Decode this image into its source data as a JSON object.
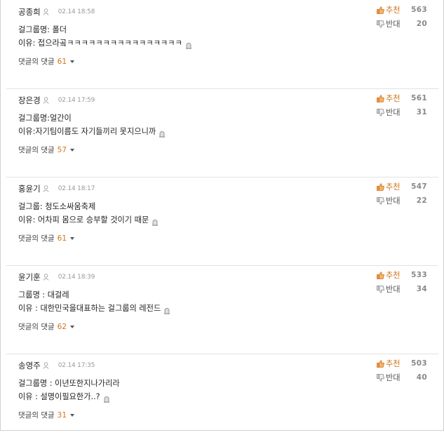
{
  "comments": [
    {
      "author": "공종희",
      "time": "02.14 18:58",
      "lines": [
        "걸그룹명: 폴더",
        "이유: 접으라곸ㅋㅋㅋㅋㅋㅋㅋㅋㅋㅋㅋㅋㅋㅋㅋㅋ"
      ],
      "replies_label": "댓글의 댓글",
      "replies_count": "61",
      "up_label": "추천",
      "up_count": "563",
      "down_label": "반대",
      "down_count": "20"
    },
    {
      "author": "장은경",
      "time": "02.14 17:59",
      "lines": [
        "걸그룹명:얼간이",
        "이유:자기팀이름도 자기들끼리 못지으니까"
      ],
      "replies_label": "댓글의 댓글",
      "replies_count": "57",
      "up_label": "추천",
      "up_count": "561",
      "down_label": "반대",
      "down_count": "31"
    },
    {
      "author": "홍윤기",
      "time": "02.14 18:17",
      "lines": [
        "걸그룹: 청도소싸움축제",
        "이유: 어차피 몸으로 승부할 것이기 때문"
      ],
      "replies_label": "댓글의 댓글",
      "replies_count": "61",
      "up_label": "추천",
      "up_count": "547",
      "down_label": "반대",
      "down_count": "22"
    },
    {
      "author": "윤기훈",
      "time": "02.14 18:39",
      "lines": [
        "그룹명 : 대걸레",
        "이유 : 대한민국을대표하는 걸그룹의 레전드"
      ],
      "replies_label": "댓글의 댓글",
      "replies_count": "62",
      "up_label": "추천",
      "up_count": "533",
      "down_label": "반대",
      "down_count": "34"
    },
    {
      "author": "송영주",
      "time": "02.14 17:35",
      "lines": [
        "걸그룹명 : 이년또한지나가리라",
        "이유 : 설명이필요한가..?"
      ],
      "replies_label": "댓글의 댓글",
      "replies_count": "31",
      "up_label": "추천",
      "up_count": "503",
      "down_label": "반대",
      "down_count": "40"
    }
  ],
  "icons": {
    "user": "user-profile-icon",
    "report": "report-siren-icon",
    "up": "thumbs-up-icon",
    "down": "thumbs-down-icon",
    "caret": "caret-down-icon"
  },
  "colors": {
    "accent": "#d3731b",
    "count": "#888888",
    "divider": "#e2e2e2"
  }
}
